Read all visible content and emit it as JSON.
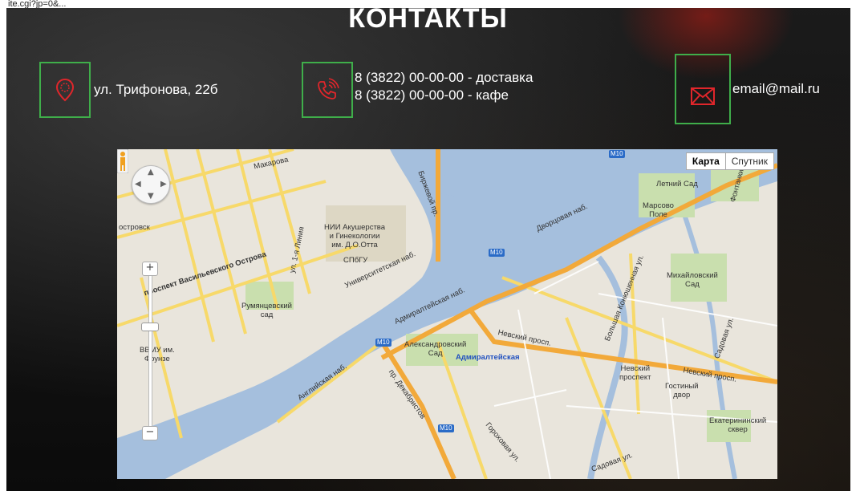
{
  "header": {
    "top_text": "ite.cgi?jp=0&...",
    "title": "КОНТАКТЫ"
  },
  "contacts": {
    "address": {
      "icon": "location-pin-icon",
      "text": "ул. Трифонова, 22б"
    },
    "phones": {
      "icon": "phone-icon",
      "delivery": "8 (3822) 00-00-00 - доставка",
      "cafe": "8 (3822) 00-00-00 - кафе"
    },
    "email": {
      "icon": "envelope-icon",
      "text": "email@mail.ru"
    }
  },
  "colors": {
    "accent_green": "#3fae4a",
    "icon_red": "#e0262b"
  },
  "map": {
    "type_buttons": {
      "map": "Карта",
      "satellite": "Спутник"
    },
    "zoom_in": "+",
    "zoom_out": "−",
    "labels": {
      "makarova": "Макарова",
      "institute": "НИИ Акушерства\nи Гинекологии\nим. Д.О.Отта",
      "spbgu": "СПбГУ",
      "rumyantsevsky": "Румянцевский\nсад",
      "vvmu": "ВВМУ им.\nФрунзе",
      "alexandrovsky": "Александровский\nСад",
      "admiralteyskaya": "Адмиралтейская",
      "letniy": "Летний Сад",
      "marsovo": "Марсово\nПоле",
      "mikhaylovsky": "Михайловский\nСад",
      "nevsky_metro": "Невский\nпроспект",
      "gostiny": "Гостиный\nдвор",
      "ekaterininsky": "Екатерининский\nсквер",
      "vasilyevsky": "проспект Васильевского Острова",
      "universitetskaya": "Университетская наб.",
      "admiralteyskaya_nab": "Адмиралтейская наб.",
      "dvortsovaya": "Дворцовая наб.",
      "nevsky_prosp": "Невский просп.",
      "nevsky_prosp2": "Невский просп.",
      "angliyskaya": "Английская наб.",
      "dekabristov": "пр. Декабристов",
      "sadovaya": "Садовая ул.",
      "sadovaya2": "Садовая ул.",
      "gorokhovaya": "Гороховая ул.",
      "konyushennaya": "Большая Конюшенная ул.",
      "fontanka": "Фонтанки",
      "birzhevoy": "Биржевой пр.",
      "liniya1": "ул. 1-я Линия",
      "ostrovsk": "островск",
      "m10": "M10"
    }
  }
}
